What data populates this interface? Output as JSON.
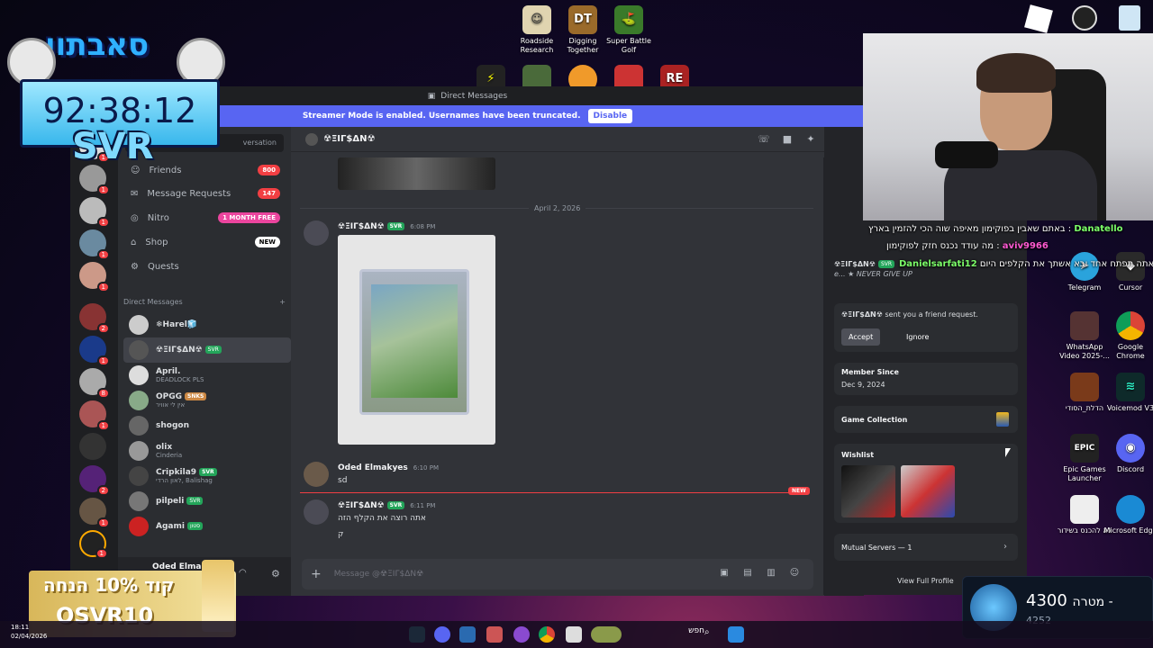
{
  "desktop": {
    "top_icons": [
      {
        "label": "Roadside Research",
        "icon": "face-icon",
        "color": "#e0d4b0"
      },
      {
        "label": "Digging Together",
        "icon": "dt-icon",
        "color": "#9a6a2a"
      },
      {
        "label": "Super Battle Golf",
        "icon": "golf-icon",
        "color": "#3a7a2a"
      }
    ],
    "right_icons": [
      {
        "label": "Telegram",
        "icon": "telegram-icon",
        "color": "#2aa3dc"
      },
      {
        "label": "Cursor",
        "icon": "cursor-icon",
        "color": "#2a2a2a"
      },
      {
        "label": "WhatsApp Video 2025-...",
        "icon": "video-file-icon",
        "color": "#553333"
      },
      {
        "label": "Google Chrome",
        "icon": "chrome-icon",
        "color": "#e8c42a"
      },
      {
        "label": "הדלת_הסודי",
        "icon": "image-file-icon",
        "color": "#7a3a1a"
      },
      {
        "label": "Voicemod V3",
        "icon": "voicemod-icon",
        "color": "#0e2a2a"
      },
      {
        "label": "Epic Games Launcher",
        "icon": "epic-icon",
        "color": "#222"
      },
      {
        "label": "Discord",
        "icon": "discord-icon",
        "color": "#5865f2"
      },
      {
        "label": "לא להכנס בשידור",
        "icon": "text-file-icon",
        "color": "#eee"
      },
      {
        "label": "Microsoft Edge",
        "icon": "edge-icon",
        "color": "#1a8ad4"
      }
    ]
  },
  "overlay": {
    "timer": "92:38:12",
    "timer_sub": "SVR",
    "logo_text": "סאבתון",
    "promo_line1": "קוד 10% הנחה",
    "promo_line2": "OSVR10",
    "goal_value": "4300",
    "goal_sub": "4252",
    "goal_label": "מטרה -",
    "chat": [
      {
        "user": "Danatello",
        "text": "באתם שאבין בפוקימון מאיפה שוה הכי להזמין בארץ :"
      },
      {
        "user": "aviv9966",
        "text": "מה עודד נכנס חזק לפוקימון :"
      },
      {
        "user": "Danielsarfati12",
        "text": "אתה תפתח אחד ובא אשתך את הקלפים היום :"
      }
    ]
  },
  "discord": {
    "window_title": "Direct Messages",
    "streamer_text": "Streamer Mode is enabled. Usernames have been truncated.",
    "disable_label": "Disable",
    "search_placeholder": "versation",
    "nav": [
      {
        "label": "Friends",
        "badge": "800",
        "icon": "friends-icon"
      },
      {
        "label": "Message Requests",
        "badge": "147",
        "icon": "mail-icon"
      },
      {
        "label": "Nitro",
        "badge": "1 MONTH FREE",
        "icon": "nitro-icon"
      },
      {
        "label": "Shop",
        "badge": "NEW",
        "icon": "shop-icon"
      },
      {
        "label": "Quests",
        "badge": "",
        "icon": "quests-icon"
      }
    ],
    "dm_header": "Direct Messages",
    "dms": [
      {
        "name": "❄Harel🧊",
        "sub": "",
        "tag": ""
      },
      {
        "name": "☢ΞIΓ$ΔN☢",
        "sub": "",
        "tag": "SVR"
      },
      {
        "name": "April.",
        "sub": "DEADLOCK PLS",
        "tag": ""
      },
      {
        "name": "OPGG",
        "sub": "אין לי אוויר",
        "tag": "SNKS"
      },
      {
        "name": "shogon",
        "sub": "",
        "tag": ""
      },
      {
        "name": "olix",
        "sub": "Cinderia",
        "tag": ""
      },
      {
        "name": "Cripkila9",
        "sub": "לאון הרדי, Balishag",
        "tag": "SVR"
      },
      {
        "name": "pilpeli",
        "sub": "",
        "tag": "SVR"
      },
      {
        "name": "Agami",
        "sub": "",
        "tag": "סטון"
      }
    ],
    "user_name": "Oded Elmakyes",
    "chat_title": "☢ΞIΓ$ΔN☢",
    "date_divider": "April 2, 2026",
    "messages": [
      {
        "name": "☢ΞIΓ$ΔN☢",
        "tag": "SVR",
        "time": "6:08 PM",
        "text": ""
      },
      {
        "name": "Oded Elmakyes",
        "tag": "",
        "time": "6:10 PM",
        "text": "sd"
      },
      {
        "name": "☢ΞIΓ$ΔN☢",
        "tag": "SVR",
        "time": "6:11 PM",
        "text": "אתה רוצה את הקלף הזה"
      },
      {
        "name": "",
        "tag": "",
        "time": "",
        "text": "ק"
      }
    ],
    "new_label": "NEW",
    "composer_placeholder": "Message @☢ΞIΓ$ΔN☢",
    "profile": {
      "name": "☢ΞIΓ$ΔN☢",
      "tag": "SVR",
      "bio": "e... ★ NEVER GIVE UP",
      "friend_request": "sent you a friend request.",
      "accept": "Accept",
      "ignore": "Ignore",
      "member_since_label": "Member Since",
      "member_since": "Dec 9, 2024",
      "game_collection": "Game Collection",
      "wishlist": "Wishlist",
      "mutual_servers": "Mutual Servers — 1",
      "view_full": "View Full Profile"
    }
  },
  "taskbar": {
    "time": "18:11",
    "date": "02/04/2026",
    "search": "חפש"
  }
}
